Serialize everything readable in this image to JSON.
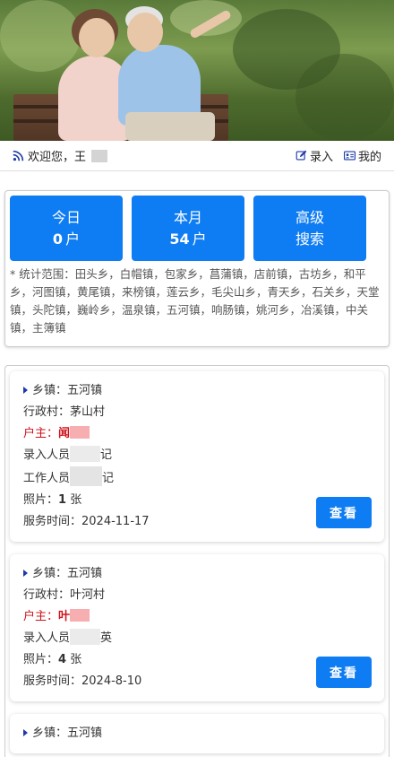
{
  "welcome": {
    "greeting": "欢迎您，王",
    "enter_label": "录入",
    "mine_label": "我的"
  },
  "stats": {
    "today": {
      "label": "今日",
      "count": "0",
      "unit": "户"
    },
    "month": {
      "label": "本月",
      "count": "54",
      "unit": "户"
    },
    "search": {
      "line1": "高级",
      "line2": "搜索"
    },
    "scope": "* 统计范围：田头乡，白帽镇，包家乡，菖蒲镇，店前镇，古坊乡，和平乡，河图镇，黄尾镇，来榜镇，莲云乡，毛尖山乡，青天乡，石关乡，天堂镇，头陀镇，巍岭乡，温泉镇，五河镇，响肠镇，姚河乡，冶溪镇，中关镇，主簿镇"
  },
  "records": [
    {
      "town_label": "乡镇：",
      "town": "五河镇",
      "village_label": "行政村：",
      "village": "茅山村",
      "owner_label": "户主：",
      "owner": "闻",
      "entry_label": "录入人员",
      "entry_suffix": "记",
      "staff_label": "工作人员",
      "staff_suffix": "记",
      "photo_label": "照片：",
      "photo_count": "1",
      "photo_unit": " 张",
      "time_label": "服务时间：",
      "time": "2024-11-17",
      "view_label": "查看"
    },
    {
      "town_label": "乡镇：",
      "town": "五河镇",
      "village_label": "行政村：",
      "village": "叶河村",
      "owner_label": "户主：",
      "owner": "叶",
      "entry_label": "录入人员",
      "entry_suffix": "英",
      "photo_label": "照片：",
      "photo_count": "4",
      "photo_unit": " 张",
      "time_label": "服务时间：",
      "time": "2024-8-10",
      "view_label": "查看"
    },
    {
      "town_label": "乡镇：",
      "town": "五河镇"
    }
  ],
  "colors": {
    "primary": "#0e7cf2",
    "owner_red": "#d0121b",
    "icon_blue": "#1e3aa8"
  }
}
